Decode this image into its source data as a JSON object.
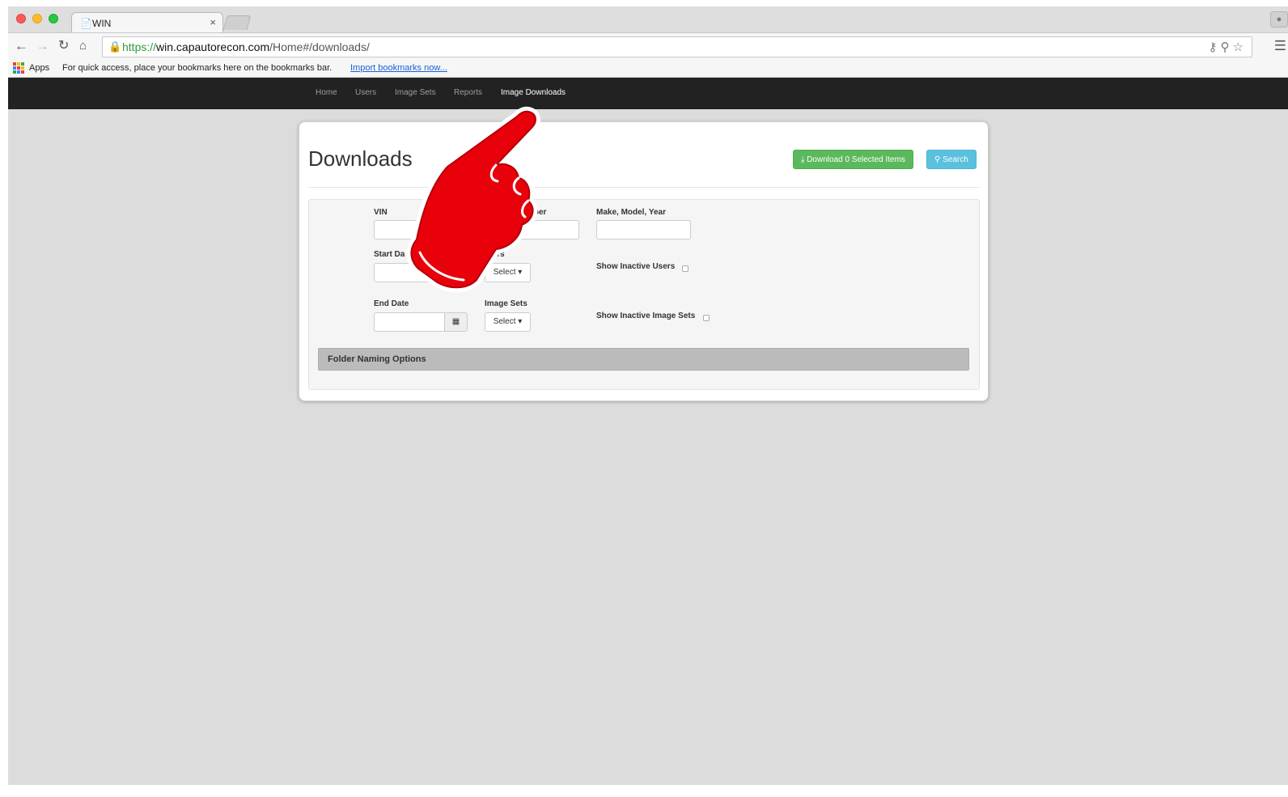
{
  "browser": {
    "tab_icon": "page-icon",
    "tab_title": "WIN",
    "tab_close": "×",
    "url_scheme": "https://",
    "url_host": "win.capautorecon.com",
    "url_path": "/Home#/downloads/",
    "bookmarks_bar": {
      "apps_label": "Apps",
      "hint": "For quick access, place your bookmarks here on the bookmarks bar.",
      "import_link": "Import bookmarks now..."
    }
  },
  "site_nav": {
    "items": [
      {
        "label": "Home"
      },
      {
        "label": "Users"
      },
      {
        "label": "Image Sets"
      },
      {
        "label": "Reports"
      },
      {
        "label": "Image Downloads",
        "active": true
      }
    ]
  },
  "page": {
    "title": "Downloads",
    "download_button": "Download 0 Selected Items",
    "search_button": "Search",
    "filters": {
      "vin_label": "VIN",
      "stock_label_fragment": "mber",
      "make_model_year_label": "Make, Model, Year",
      "start_date_label": "Start Da",
      "users_label_fragment": "sers",
      "show_inactive_users_label": "Show Inactive Users",
      "end_date_label": "End Date",
      "image_sets_label": "Image Sets",
      "show_inactive_image_sets_label": "Show Inactive Image Sets",
      "select_label": "Select"
    },
    "folder_naming_label": "Folder Naming Options"
  },
  "colors": {
    "nav_bg": "#222222",
    "btn_green": "#5cb85c",
    "btn_blue": "#5bc0de",
    "pointer_red": "#e8000b"
  }
}
